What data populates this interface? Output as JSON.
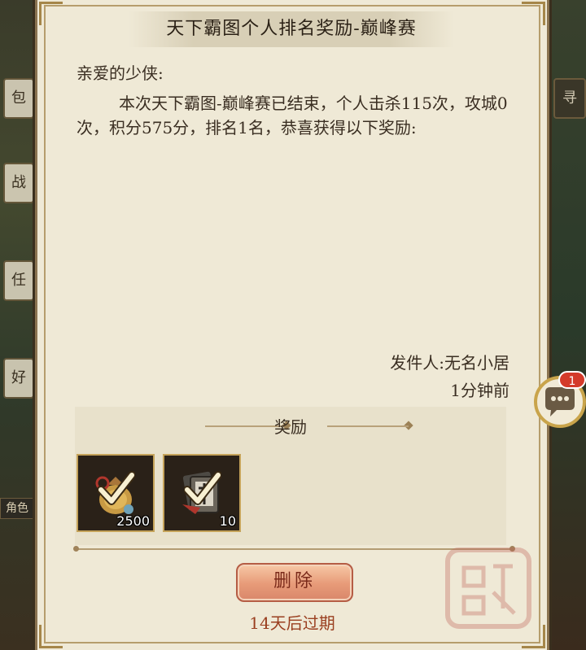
{
  "side_menu": {
    "left_tabs": [
      "包",
      "战",
      "任",
      "好"
    ],
    "role_label": "角色",
    "right_tab": "寻"
  },
  "mail": {
    "title": "天下霸图个人排名奖励-巅峰赛",
    "greeting": "亲爱的少侠:",
    "body": "本次天下霸图-巅峰赛已结束，个人击杀115次，攻城0次，积分575分，排名1名，恭喜获得以下奖励:",
    "sender": "发件人:无名小居",
    "time": "1分钟前",
    "reward_title": "奖励",
    "rewards": [
      {
        "icon": "money-bag-icon",
        "count": "2500",
        "claimed": true
      },
      {
        "icon": "token-card-icon",
        "count": "10",
        "claimed": true
      }
    ],
    "delete_label": "删除",
    "expire": "14天后过期"
  },
  "chat": {
    "badge": "1",
    "icon": "chat-icon"
  },
  "colors": {
    "paper": "#efe9d6",
    "frame": "#8a7350",
    "button": "#e79a78",
    "expire_text": "#9a3f20",
    "badge": "#d43a2a"
  }
}
